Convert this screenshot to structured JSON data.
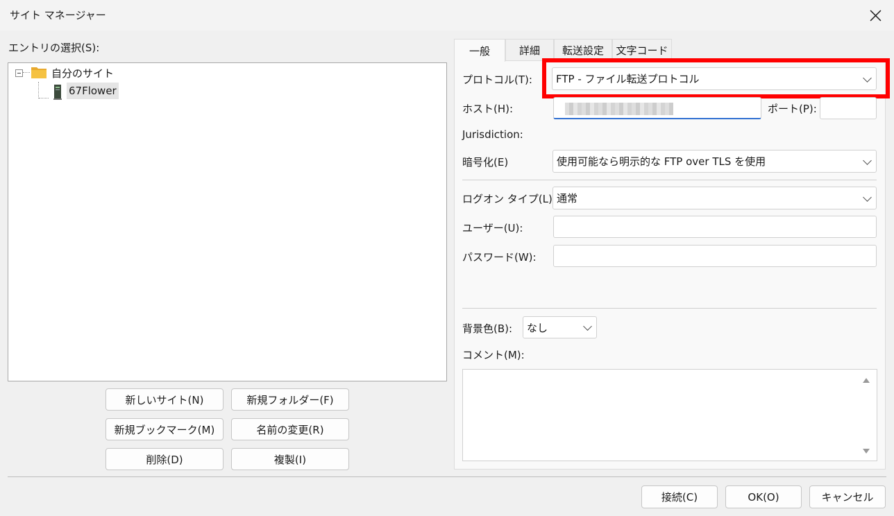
{
  "window": {
    "title": "サイト マネージャー",
    "close_icon": "close-icon"
  },
  "entries": {
    "label": "エントリの選択(S):",
    "tree": [
      {
        "label": "自分のサイト",
        "icon": "folder-icon",
        "expanded": true,
        "children": [
          {
            "label": "67Flower",
            "icon": "server-icon",
            "selected": true
          }
        ]
      }
    ]
  },
  "left_buttons": {
    "new_site": "新しいサイト(N)",
    "new_folder": "新規フォルダー(F)",
    "new_bookmark": "新規ブックマーク(M)",
    "rename": "名前の変更(R)",
    "delete": "削除(D)",
    "duplicate": "複製(I)"
  },
  "tabs": [
    {
      "label": "一般",
      "active": true
    },
    {
      "label": "詳細",
      "active": false
    },
    {
      "label": "転送設定",
      "active": false
    },
    {
      "label": "文字コード",
      "active": false
    }
  ],
  "general": {
    "protocol_label": "プロトコル(T):",
    "protocol_value": "FTP - ファイル転送プロトコル",
    "host_label": "ホスト(H):",
    "port_label": "ポート(P):",
    "port_value": "",
    "jurisdiction_label": "Jurisdiction:",
    "encryption_label": "暗号化(E)",
    "encryption_value": "使用可能なら明示的な FTP over TLS を使用",
    "logon_label": "ログオン タイプ(L):",
    "logon_value": "通常",
    "user_label": "ユーザー(U):",
    "user_value": "",
    "password_label": "パスワード(W):",
    "password_value": "",
    "bgcolor_label": "背景色(B):",
    "bgcolor_value": "なし",
    "comment_label": "コメント(M):",
    "comment_value": ""
  },
  "footer_buttons": {
    "connect": "接続(C)",
    "ok": "OK(O)",
    "cancel": "キャンセル"
  },
  "colors": {
    "highlight_box": "#ff0000",
    "selection": "#e5e5e5",
    "folder": "#f5c242"
  }
}
